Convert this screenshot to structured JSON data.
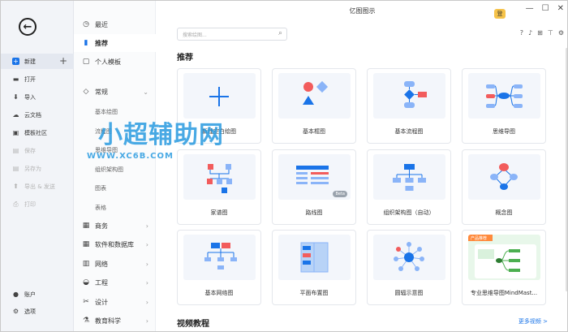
{
  "window": {
    "title": "亿图图示",
    "avatar_text": "登",
    "minimize": "—",
    "maximize": "☐",
    "close": "✕"
  },
  "left_nav": {
    "new": "新建",
    "open": "打开",
    "import": "导入",
    "cloud": "云文档",
    "community": "模板社区",
    "save": "保存",
    "save_as": "另存为",
    "export_send": "导出 & 发送",
    "print": "打印",
    "account": "账户",
    "options": "选项"
  },
  "mid_nav": {
    "recent": "最近",
    "recommend": "推荐",
    "personal": "个人模板",
    "common": "常规",
    "sub": [
      "基本绘图",
      "流程图",
      "思维导图",
      "组织架构图",
      "图表",
      "表格"
    ],
    "business": "商务",
    "software": "软件和数据库",
    "network": "网络",
    "engineering": "工程",
    "design": "设计",
    "education": "教育科学"
  },
  "search": {
    "placeholder": "搜索绘图..."
  },
  "sections": {
    "recommend": "推荐",
    "video": "视频教程",
    "more_video": "更多视频 >"
  },
  "cards": [
    {
      "label": "新建空白绘图"
    },
    {
      "label": "基本框图"
    },
    {
      "label": "基本流程图"
    },
    {
      "label": "思维导图"
    },
    {
      "label": "家谱图"
    },
    {
      "label": "路线图",
      "badge": "Beta"
    },
    {
      "label": "组织架构图（自动）"
    },
    {
      "label": "概念图"
    },
    {
      "label": "基本网络图"
    },
    {
      "label": "平面布置图"
    },
    {
      "label": "圆辐示意图"
    },
    {
      "label": "专业思维导图MindMast...",
      "badge": "产品推荐"
    }
  ],
  "watermark": {
    "line1": "小超辅助网",
    "line2": "WWW.XC6B.COM"
  },
  "colors": {
    "accent": "#1a74e8",
    "red": "#f25c5c",
    "blue": "#3a8df0"
  }
}
